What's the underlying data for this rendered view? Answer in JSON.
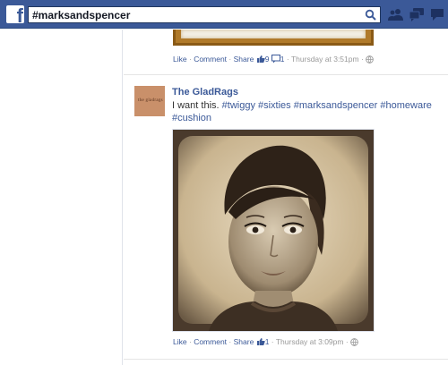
{
  "header": {
    "logo_letter": "f",
    "search_value": "#marksandspencer"
  },
  "stories": [
    {
      "actions": {
        "like": "Like",
        "comment": "Comment",
        "share": "Share",
        "likes_count": "9",
        "comments_count": "1",
        "timestamp": "Thursday at 3:51pm"
      }
    },
    {
      "author": "The GladRags",
      "avatar_text": "the gladrags",
      "text_plain": "I want this.",
      "hashtags": [
        "#twiggy",
        "#sixties",
        "#marksandspencer",
        "#homeware",
        "#cushion"
      ],
      "actions": {
        "like": "Like",
        "comment": "Comment",
        "share": "Share",
        "likes_count": "1",
        "timestamp": "Thursday at 3:09pm"
      }
    }
  ],
  "separator_dot": "·",
  "colors": {
    "topbar": "#3b5998",
    "link": "#3b5998",
    "meta": "#999999"
  }
}
